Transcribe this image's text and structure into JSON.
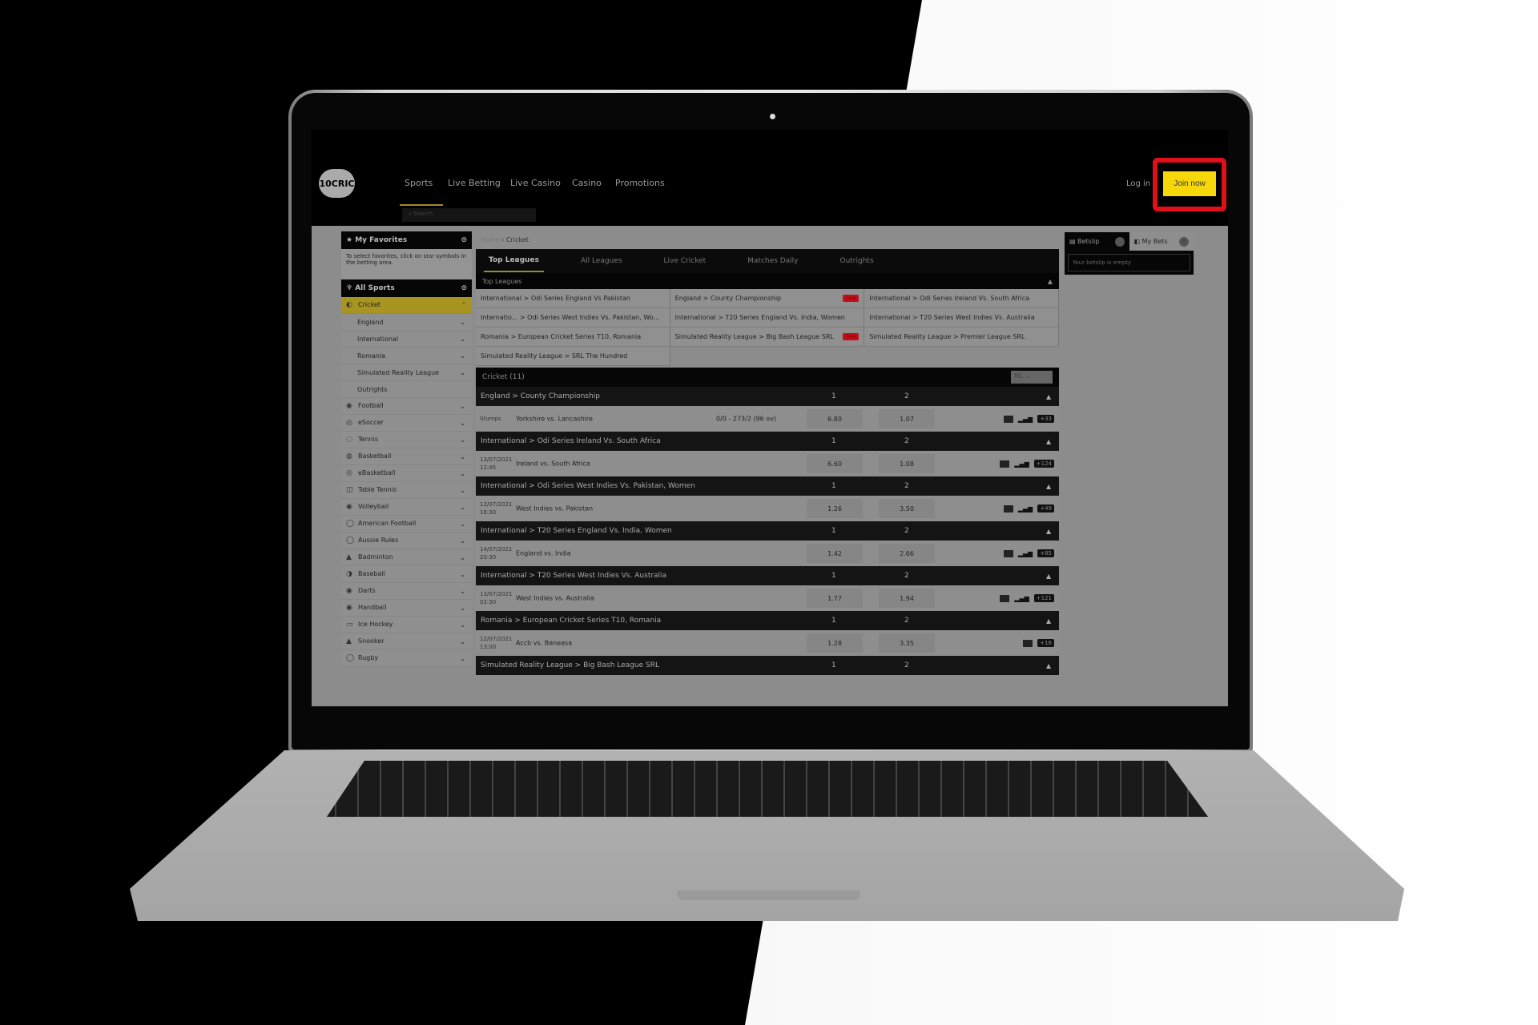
{
  "header": {
    "logo": "10CRIC",
    "nav": [
      "Sports",
      "Live Betting",
      "Live Casino",
      "Casino",
      "Promotions"
    ],
    "search_placeholder": "Search",
    "login": "Log in",
    "join": "Join now",
    "accent": "#f6d80a",
    "highlight_color": "#e0101a"
  },
  "sidebar": {
    "favorites_title": "My Favorites",
    "favorites_note": "To select favorites, click on star symbols in the betting area.",
    "all_sports_title": "All Sports",
    "active": {
      "label": "Cricket",
      "icon": "cricket-ball-icon"
    },
    "sub_items": [
      "England",
      "International",
      "Romania",
      "Simulated Reality League",
      "Outrights"
    ],
    "sports": [
      "Football",
      "eSoccer",
      "Tennis",
      "Basketball",
      "eBasketball",
      "Table Tennis",
      "Volleyball",
      "American Football",
      "Aussie Rules",
      "Badminton",
      "Baseball",
      "Darts",
      "Handball",
      "Ice Hockey",
      "Snooker",
      "Rugby"
    ]
  },
  "main": {
    "breadcrumb": [
      "Home",
      "Cricket"
    ],
    "tabs": [
      "Top Leagues",
      "All Leagues",
      "Live Cricket",
      "Matches Daily",
      "Outrights"
    ],
    "top_leagues_title": "Top Leagues",
    "top_leagues": [
      {
        "label": "International > Odi Series England Vs Pakistan",
        "live": false
      },
      {
        "label": "England > County Championship",
        "live": true
      },
      {
        "label": "International > Odi Series Ireland Vs. South Africa",
        "live": false
      },
      {
        "label": "Internatio... > Odi Series West Indies Vs. Pakistan, Wo...",
        "live": false
      },
      {
        "label": "International > T20 Series England Vs. India, Women",
        "live": false
      },
      {
        "label": "International > T20 Series West Indies Vs. Australia",
        "live": false
      },
      {
        "label": "Romania > European Cricket Series T10, Romania",
        "live": false
      },
      {
        "label": "Simulated Reality League > Big Bash League SRL",
        "live": true
      },
      {
        "label": "Simulated Reality League > Premier League SRL",
        "live": false
      },
      {
        "label": "Simulated Reality League > SRL The Hundred",
        "live": false
      }
    ],
    "live_label": "Live",
    "cricket_title": "Cricket (11)",
    "market_select": "ML",
    "col1": "1",
    "col2": "2",
    "sections": [
      {
        "title": "England > County Championship",
        "match": {
          "time": "Stumps",
          "date": "",
          "teams": "Yorkshire vs. Lancashire",
          "score": "0/0 - 273/2 (96 ov)",
          "odd1": "6.80",
          "odd2": "1.07",
          "more": "+33",
          "stats": true
        }
      },
      {
        "title": "International > Odi Series Ireland Vs. South Africa",
        "match": {
          "date": "13/07/2021",
          "time": "12:45",
          "teams": "Ireland vs. South Africa",
          "score": "",
          "odd1": "6.60",
          "odd2": "1.08",
          "more": "+124",
          "stats": true
        }
      },
      {
        "title": "International > Odi Series West Indies Vs. Pakistan, Women",
        "match": {
          "date": "12/07/2021",
          "time": "16:30",
          "teams": "West Indies vs. Pakistan",
          "score": "",
          "odd1": "1.26",
          "odd2": "3.50",
          "more": "+49",
          "stats": true
        }
      },
      {
        "title": "International > T20 Series England Vs. India, Women",
        "match": {
          "date": "14/07/2021",
          "time": "20:30",
          "teams": "England vs. India",
          "score": "",
          "odd1": "1.42",
          "odd2": "2.66",
          "more": "+85",
          "stats": true
        }
      },
      {
        "title": "International > T20 Series West Indies Vs. Australia",
        "match": {
          "date": "13/07/2021",
          "time": "02:30",
          "teams": "West Indies vs. Australia",
          "score": "",
          "odd1": "1.77",
          "odd2": "1.94",
          "more": "+121",
          "stats": true
        }
      },
      {
        "title": "Romania > European Cricket Series T10, Romania",
        "match": {
          "date": "12/07/2021",
          "time": "13:00",
          "teams": "Accb vs. Baneasa",
          "score": "",
          "odd1": "1.28",
          "odd2": "3.35",
          "more": "+16",
          "stats": false
        }
      },
      {
        "title": "Simulated Reality League > Big Bash League SRL"
      }
    ]
  },
  "betslip": {
    "tab_betslip": "Betslip",
    "tab_mybets": "My Bets",
    "mybets_count": "0",
    "empty": "Your betslip is empty"
  }
}
